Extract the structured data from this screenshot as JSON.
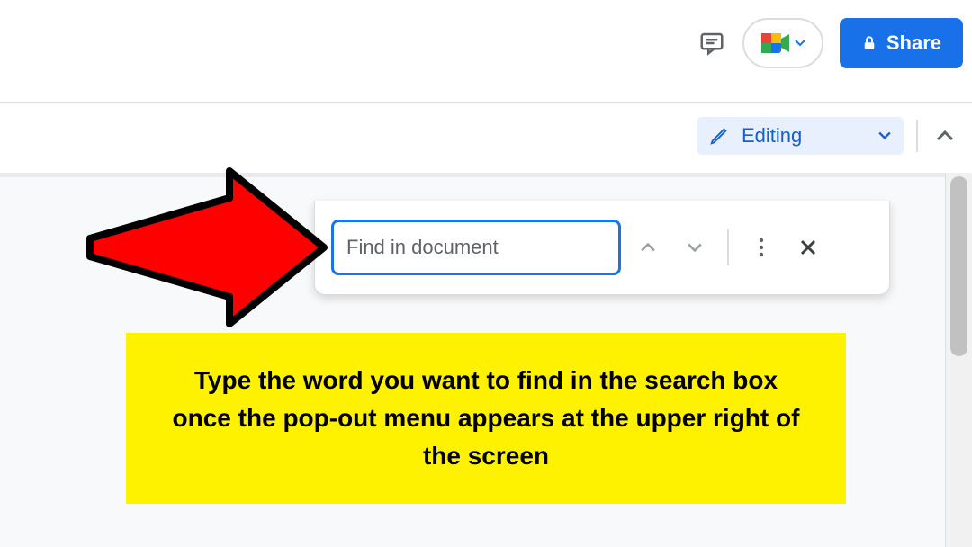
{
  "topbar": {
    "share_label": "Share"
  },
  "editing": {
    "label": "Editing"
  },
  "find": {
    "placeholder": "Find in document"
  },
  "annotation": {
    "caption": "Type the word you want to find in the search box once the pop-out menu appears at the upper right of the screen",
    "arrow_color": "#ff0000"
  },
  "icons": {
    "comment": "comment-icon",
    "meet": "meet-icon",
    "lock": "lock-icon",
    "pencil": "pencil-icon",
    "caret_down": "caret-down-icon",
    "chevron_up": "chevron-up-icon",
    "chevron_down": "chevron-down-icon",
    "more": "more-vertical-icon",
    "close": "close-icon"
  }
}
